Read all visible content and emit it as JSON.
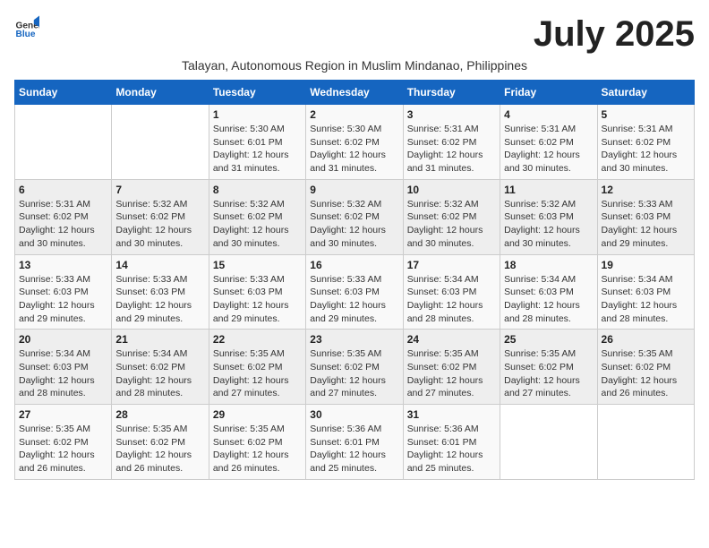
{
  "header": {
    "logo_general": "General",
    "logo_blue": "Blue",
    "month_title": "July 2025",
    "subtitle": "Talayan, Autonomous Region in Muslim Mindanao, Philippines"
  },
  "weekdays": [
    "Sunday",
    "Monday",
    "Tuesday",
    "Wednesday",
    "Thursday",
    "Friday",
    "Saturday"
  ],
  "weeks": [
    [
      {
        "num": "",
        "detail": ""
      },
      {
        "num": "",
        "detail": ""
      },
      {
        "num": "1",
        "detail": "Sunrise: 5:30 AM\nSunset: 6:01 PM\nDaylight: 12 hours and 31 minutes."
      },
      {
        "num": "2",
        "detail": "Sunrise: 5:30 AM\nSunset: 6:02 PM\nDaylight: 12 hours and 31 minutes."
      },
      {
        "num": "3",
        "detail": "Sunrise: 5:31 AM\nSunset: 6:02 PM\nDaylight: 12 hours and 31 minutes."
      },
      {
        "num": "4",
        "detail": "Sunrise: 5:31 AM\nSunset: 6:02 PM\nDaylight: 12 hours and 30 minutes."
      },
      {
        "num": "5",
        "detail": "Sunrise: 5:31 AM\nSunset: 6:02 PM\nDaylight: 12 hours and 30 minutes."
      }
    ],
    [
      {
        "num": "6",
        "detail": "Sunrise: 5:31 AM\nSunset: 6:02 PM\nDaylight: 12 hours and 30 minutes."
      },
      {
        "num": "7",
        "detail": "Sunrise: 5:32 AM\nSunset: 6:02 PM\nDaylight: 12 hours and 30 minutes."
      },
      {
        "num": "8",
        "detail": "Sunrise: 5:32 AM\nSunset: 6:02 PM\nDaylight: 12 hours and 30 minutes."
      },
      {
        "num": "9",
        "detail": "Sunrise: 5:32 AM\nSunset: 6:02 PM\nDaylight: 12 hours and 30 minutes."
      },
      {
        "num": "10",
        "detail": "Sunrise: 5:32 AM\nSunset: 6:02 PM\nDaylight: 12 hours and 30 minutes."
      },
      {
        "num": "11",
        "detail": "Sunrise: 5:32 AM\nSunset: 6:03 PM\nDaylight: 12 hours and 30 minutes."
      },
      {
        "num": "12",
        "detail": "Sunrise: 5:33 AM\nSunset: 6:03 PM\nDaylight: 12 hours and 29 minutes."
      }
    ],
    [
      {
        "num": "13",
        "detail": "Sunrise: 5:33 AM\nSunset: 6:03 PM\nDaylight: 12 hours and 29 minutes."
      },
      {
        "num": "14",
        "detail": "Sunrise: 5:33 AM\nSunset: 6:03 PM\nDaylight: 12 hours and 29 minutes."
      },
      {
        "num": "15",
        "detail": "Sunrise: 5:33 AM\nSunset: 6:03 PM\nDaylight: 12 hours and 29 minutes."
      },
      {
        "num": "16",
        "detail": "Sunrise: 5:33 AM\nSunset: 6:03 PM\nDaylight: 12 hours and 29 minutes."
      },
      {
        "num": "17",
        "detail": "Sunrise: 5:34 AM\nSunset: 6:03 PM\nDaylight: 12 hours and 28 minutes."
      },
      {
        "num": "18",
        "detail": "Sunrise: 5:34 AM\nSunset: 6:03 PM\nDaylight: 12 hours and 28 minutes."
      },
      {
        "num": "19",
        "detail": "Sunrise: 5:34 AM\nSunset: 6:03 PM\nDaylight: 12 hours and 28 minutes."
      }
    ],
    [
      {
        "num": "20",
        "detail": "Sunrise: 5:34 AM\nSunset: 6:03 PM\nDaylight: 12 hours and 28 minutes."
      },
      {
        "num": "21",
        "detail": "Sunrise: 5:34 AM\nSunset: 6:02 PM\nDaylight: 12 hours and 28 minutes."
      },
      {
        "num": "22",
        "detail": "Sunrise: 5:35 AM\nSunset: 6:02 PM\nDaylight: 12 hours and 27 minutes."
      },
      {
        "num": "23",
        "detail": "Sunrise: 5:35 AM\nSunset: 6:02 PM\nDaylight: 12 hours and 27 minutes."
      },
      {
        "num": "24",
        "detail": "Sunrise: 5:35 AM\nSunset: 6:02 PM\nDaylight: 12 hours and 27 minutes."
      },
      {
        "num": "25",
        "detail": "Sunrise: 5:35 AM\nSunset: 6:02 PM\nDaylight: 12 hours and 27 minutes."
      },
      {
        "num": "26",
        "detail": "Sunrise: 5:35 AM\nSunset: 6:02 PM\nDaylight: 12 hours and 26 minutes."
      }
    ],
    [
      {
        "num": "27",
        "detail": "Sunrise: 5:35 AM\nSunset: 6:02 PM\nDaylight: 12 hours and 26 minutes."
      },
      {
        "num": "28",
        "detail": "Sunrise: 5:35 AM\nSunset: 6:02 PM\nDaylight: 12 hours and 26 minutes."
      },
      {
        "num": "29",
        "detail": "Sunrise: 5:35 AM\nSunset: 6:02 PM\nDaylight: 12 hours and 26 minutes."
      },
      {
        "num": "30",
        "detail": "Sunrise: 5:36 AM\nSunset: 6:01 PM\nDaylight: 12 hours and 25 minutes."
      },
      {
        "num": "31",
        "detail": "Sunrise: 5:36 AM\nSunset: 6:01 PM\nDaylight: 12 hours and 25 minutes."
      },
      {
        "num": "",
        "detail": ""
      },
      {
        "num": "",
        "detail": ""
      }
    ]
  ]
}
